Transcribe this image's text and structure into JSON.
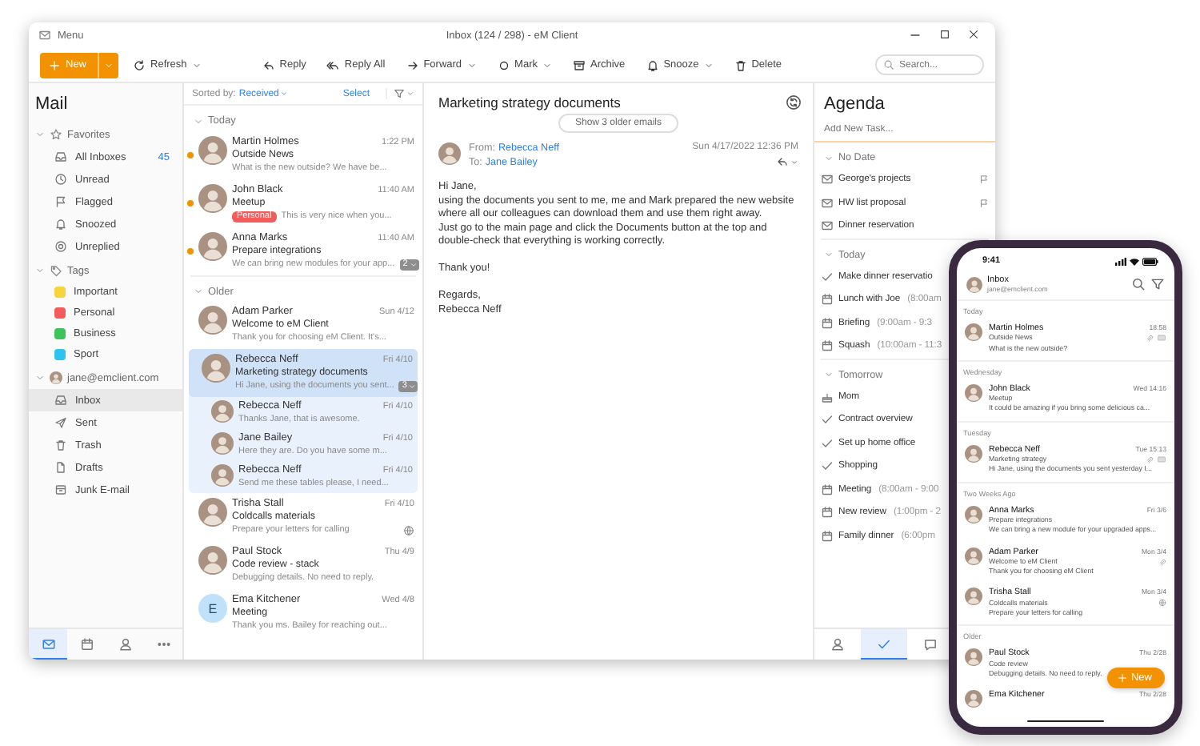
{
  "window": {
    "menu": "Menu",
    "title": "Inbox (124 / 298) - eM Client"
  },
  "toolbar": {
    "new_button": {
      "label": "New"
    },
    "buttons": [
      {
        "label": "Refresh",
        "dropdown": true
      },
      {
        "label": "Reply",
        "dropdown": false
      },
      {
        "label": "Reply All",
        "dropdown": false
      },
      {
        "label": "Forward",
        "dropdown": true
      },
      {
        "label": "Mark",
        "dropdown": true
      },
      {
        "label": "Archive",
        "dropdown": false
      },
      {
        "label": "Snooze",
        "dropdown": true
      },
      {
        "label": "Delete",
        "dropdown": false
      }
    ],
    "search": {
      "placeholder": "Search..."
    }
  },
  "sidebar": {
    "title": "Mail",
    "groups": [
      {
        "kind": "favorites",
        "label": "Favorites",
        "expanded": true,
        "items": [
          {
            "label": "All Inboxes",
            "count": "45",
            "selected": false
          },
          {
            "label": "Unread",
            "selected": false
          },
          {
            "label": "Flagged",
            "selected": false
          },
          {
            "label": "Snoozed",
            "selected": false
          },
          {
            "label": "Unreplied",
            "selected": false
          }
        ]
      },
      {
        "kind": "tags",
        "label": "Tags",
        "expanded": true,
        "items": [
          {
            "label": "Important",
            "color": "#f7d33c",
            "selected": false
          },
          {
            "label": "Personal",
            "color": "#f25c5c",
            "selected": false
          },
          {
            "label": "Business",
            "color": "#3ec25a",
            "selected": false
          },
          {
            "label": "Sport",
            "color": "#2bc3f0",
            "selected": false
          }
        ]
      },
      {
        "kind": "account",
        "label": "jane@emclient.com",
        "expanded": true,
        "items": [
          {
            "label": "Inbox",
            "selected": true
          },
          {
            "label": "Sent",
            "selected": false
          },
          {
            "label": "Trash",
            "selected": false
          },
          {
            "label": "Drafts",
            "selected": false
          },
          {
            "label": "Junk E-mail",
            "selected": false
          }
        ]
      }
    ],
    "bottom_nav": [
      {
        "selected": true
      },
      {
        "selected": false
      },
      {
        "selected": false
      },
      {
        "selected": false
      }
    ]
  },
  "message_list": {
    "sort_label": "Sorted by:",
    "sort_value": "Received",
    "select": "Select",
    "sections": [
      {
        "label": "Today",
        "expanded": true,
        "messages": [
          {
            "sender": "Martin Holmes",
            "time": "1:22 PM",
            "subject": "Outside News",
            "preview": "What is the new outside? We have be...",
            "avatar": {
              "kind": "photo"
            },
            "unread": true,
            "selected": false
          },
          {
            "sender": "John Black",
            "time": "11:40 AM",
            "subject": "Meetup",
            "tag": {
              "label": "Personal",
              "color": "#f25c5c"
            },
            "preview": "This is very nice when you...",
            "avatar": {
              "kind": "photo"
            },
            "unread": true,
            "selected": false
          },
          {
            "sender": "Anna Marks",
            "time": "11:40 AM",
            "subject": "Prepare integrations",
            "preview": "We can bring new modules for your app...",
            "count": "2",
            "avatar": {
              "kind": "photo"
            },
            "unread": true,
            "selected": false
          }
        ]
      },
      {
        "label": "Older",
        "expanded": true,
        "messages": [
          {
            "sender": "Adam Parker",
            "time": "Sun 4/12",
            "subject": "Welcome to eM Client",
            "preview": "Thank you for choosing eM Client. It's...",
            "avatar": {
              "kind": "photo"
            },
            "unread": false,
            "selected": false
          },
          {
            "sender": "Rebecca Neff",
            "time": "Fri 4/10",
            "subject": "Marketing strategy documents",
            "preview": "Hi Jane, using the documents you sent...",
            "count": "3",
            "avatar": {
              "kind": "photo"
            },
            "unread": false,
            "selected": true,
            "thread": [
              {
                "sender": "Rebecca Neff",
                "time": "Fri 4/10",
                "preview": "Thanks Jane, that is awesome.",
                "avatar": {
                  "kind": "photo"
                }
              },
              {
                "sender": "Jane Bailey",
                "time": "Fri 4/10",
                "preview": "Here they are. Do you have some m...",
                "avatar": {
                  "kind": "photo"
                }
              },
              {
                "sender": "Rebecca Neff",
                "time": "Fri 4/10",
                "preview": "Send me these tables please, I need...",
                "avatar": {
                  "kind": "photo"
                }
              }
            ]
          },
          {
            "sender": "Trisha Stall",
            "time": "Fri 4/10",
            "subject": "Coldcalls materials",
            "preview": "Prepare your letters for calling",
            "status_icon": true,
            "avatar": {
              "kind": "photo"
            },
            "unread": false,
            "selected": false
          },
          {
            "sender": "Paul Stock",
            "time": "Thu 4/9",
            "subject": "Code review - stack",
            "preview": "Debugging details. No need to reply.",
            "avatar": {
              "kind": "photo"
            },
            "unread": false,
            "selected": false
          },
          {
            "sender": "Ema Kitchener",
            "time": "Wed 4/8",
            "subject": "Meeting",
            "preview": "Thank you ms. Bailey for reaching out...",
            "avatar": {
              "kind": "letter",
              "letter": "E"
            },
            "unread": false,
            "selected": false
          }
        ]
      }
    ]
  },
  "reading_pane": {
    "subject": "Marketing strategy documents",
    "older_button": "Show 3 older emails",
    "from_label": "From:",
    "from": "Rebecca Neff",
    "to_label": "To:",
    "to": "Jane Bailey",
    "date": "Sun 4/17/2022 12:36 PM",
    "avatar": {
      "kind": "photo"
    },
    "paragraphs": [
      [
        "Hi Jane,",
        "using the documents you sent to me, me and Mark prepared the new website where all our colleagues can download them and use them right away.",
        "Just go to the main page and click the Documents button at the top and double-check that everything is working correctly."
      ],
      [
        "Thank you!"
      ],
      [
        "Regards,",
        "Rebecca Neff"
      ]
    ]
  },
  "agenda": {
    "title": "Agenda",
    "add_task": {
      "placeholder": "Add New Task..."
    },
    "sections": [
      {
        "label": "No Date",
        "expanded": true,
        "items": [
          {
            "kind": "email",
            "title": "George's projects",
            "flagged": true
          },
          {
            "kind": "email",
            "title": "HW list proposal",
            "flagged": true
          },
          {
            "kind": "email",
            "title": "Dinner reservation",
            "flagged": false
          }
        ]
      },
      {
        "label": "Today",
        "expanded": true,
        "items": [
          {
            "kind": "task",
            "title": "Make dinner reservatio"
          },
          {
            "kind": "event",
            "title": "Lunch with Joe",
            "time": "(8:00am"
          },
          {
            "kind": "event",
            "title": "Briefing",
            "time": "(9:00am - 9:3"
          },
          {
            "kind": "event",
            "title": "Squash",
            "time": "(10:00am - 11:3"
          }
        ]
      },
      {
        "label": "Tomorrow",
        "expanded": true,
        "items": [
          {
            "kind": "birthday",
            "title": "Mom"
          },
          {
            "kind": "task",
            "title": "Contract overview"
          },
          {
            "kind": "task",
            "title": "Set up home office"
          },
          {
            "kind": "task",
            "title": "Shopping"
          },
          {
            "kind": "event",
            "title": "Meeting",
            "time": "(8:00am - 9:00"
          },
          {
            "kind": "event",
            "title": "New review",
            "time": "(1:00pm - 2"
          },
          {
            "kind": "event",
            "title": "Family dinner",
            "time": "(6:00pm"
          }
        ]
      }
    ],
    "bottom_nav": [
      {
        "selected": false
      },
      {
        "selected": true
      },
      {
        "selected": false
      }
    ]
  },
  "phone": {
    "status_time": "9:41",
    "header": {
      "title": "Inbox",
      "subtitle": "jane@emclient.com",
      "avatar": {
        "kind": "photo"
      }
    },
    "sections": [
      {
        "label": "Today",
        "messages": [
          {
            "sender": "Martin Holmes",
            "time": "18:58",
            "subject": "Outside News",
            "preview": "What is the new outside?",
            "avatar": {
              "kind": "photo"
            },
            "attachment": true,
            "thread_badge": true
          }
        ]
      },
      {
        "label": "Wednesday",
        "messages": [
          {
            "sender": "John Black",
            "time": "Wed 14:16",
            "subject": "Meetup",
            "preview": "It could be amazing if you bring some delicious ca...",
            "avatar": {
              "kind": "photo"
            }
          }
        ]
      },
      {
        "label": "Tuesday",
        "messages": [
          {
            "sender": "Rebecca Neff",
            "time": "Tue 15:13",
            "subject": "Marketing strategy",
            "preview": "Hi Jane, using the documents you sent yesterday I...",
            "avatar": {
              "kind": "photo"
            },
            "attachment": true,
            "thread_badge": true
          }
        ]
      },
      {
        "label": "Two Weeks Ago",
        "messages": [
          {
            "sender": "Anna Marks",
            "time": "Fri 3/6",
            "subject": "Prepare integrations",
            "preview": "We can bring a new module for your upgraded apps...",
            "avatar": {
              "kind": "photo"
            }
          },
          {
            "sender": "Adam Parker",
            "time": "Mon 3/4",
            "subject": "Welcome to eM Client",
            "preview": "Thank you for choosing eM Client",
            "avatar": {
              "kind": "photo"
            },
            "attachment": true
          },
          {
            "sender": "Trisha Stall",
            "time": "Mon 3/4",
            "subject": "Coldcalls materials",
            "preview": "Prepare your letters for calling",
            "avatar": {
              "kind": "photo"
            },
            "status_icon": true
          }
        ]
      },
      {
        "label": "Older",
        "messages": [
          {
            "sender": "Paul Stock",
            "time": "Thu 2/28",
            "subject": "Code review",
            "preview": "Debugging details. No need to reply.",
            "avatar": {
              "kind": "photo"
            }
          },
          {
            "sender": "Ema Kitchener",
            "time": "Thu 2/28",
            "avatar": {
              "kind": "photo"
            }
          }
        ]
      }
    ],
    "fab": {
      "label": "New"
    }
  }
}
